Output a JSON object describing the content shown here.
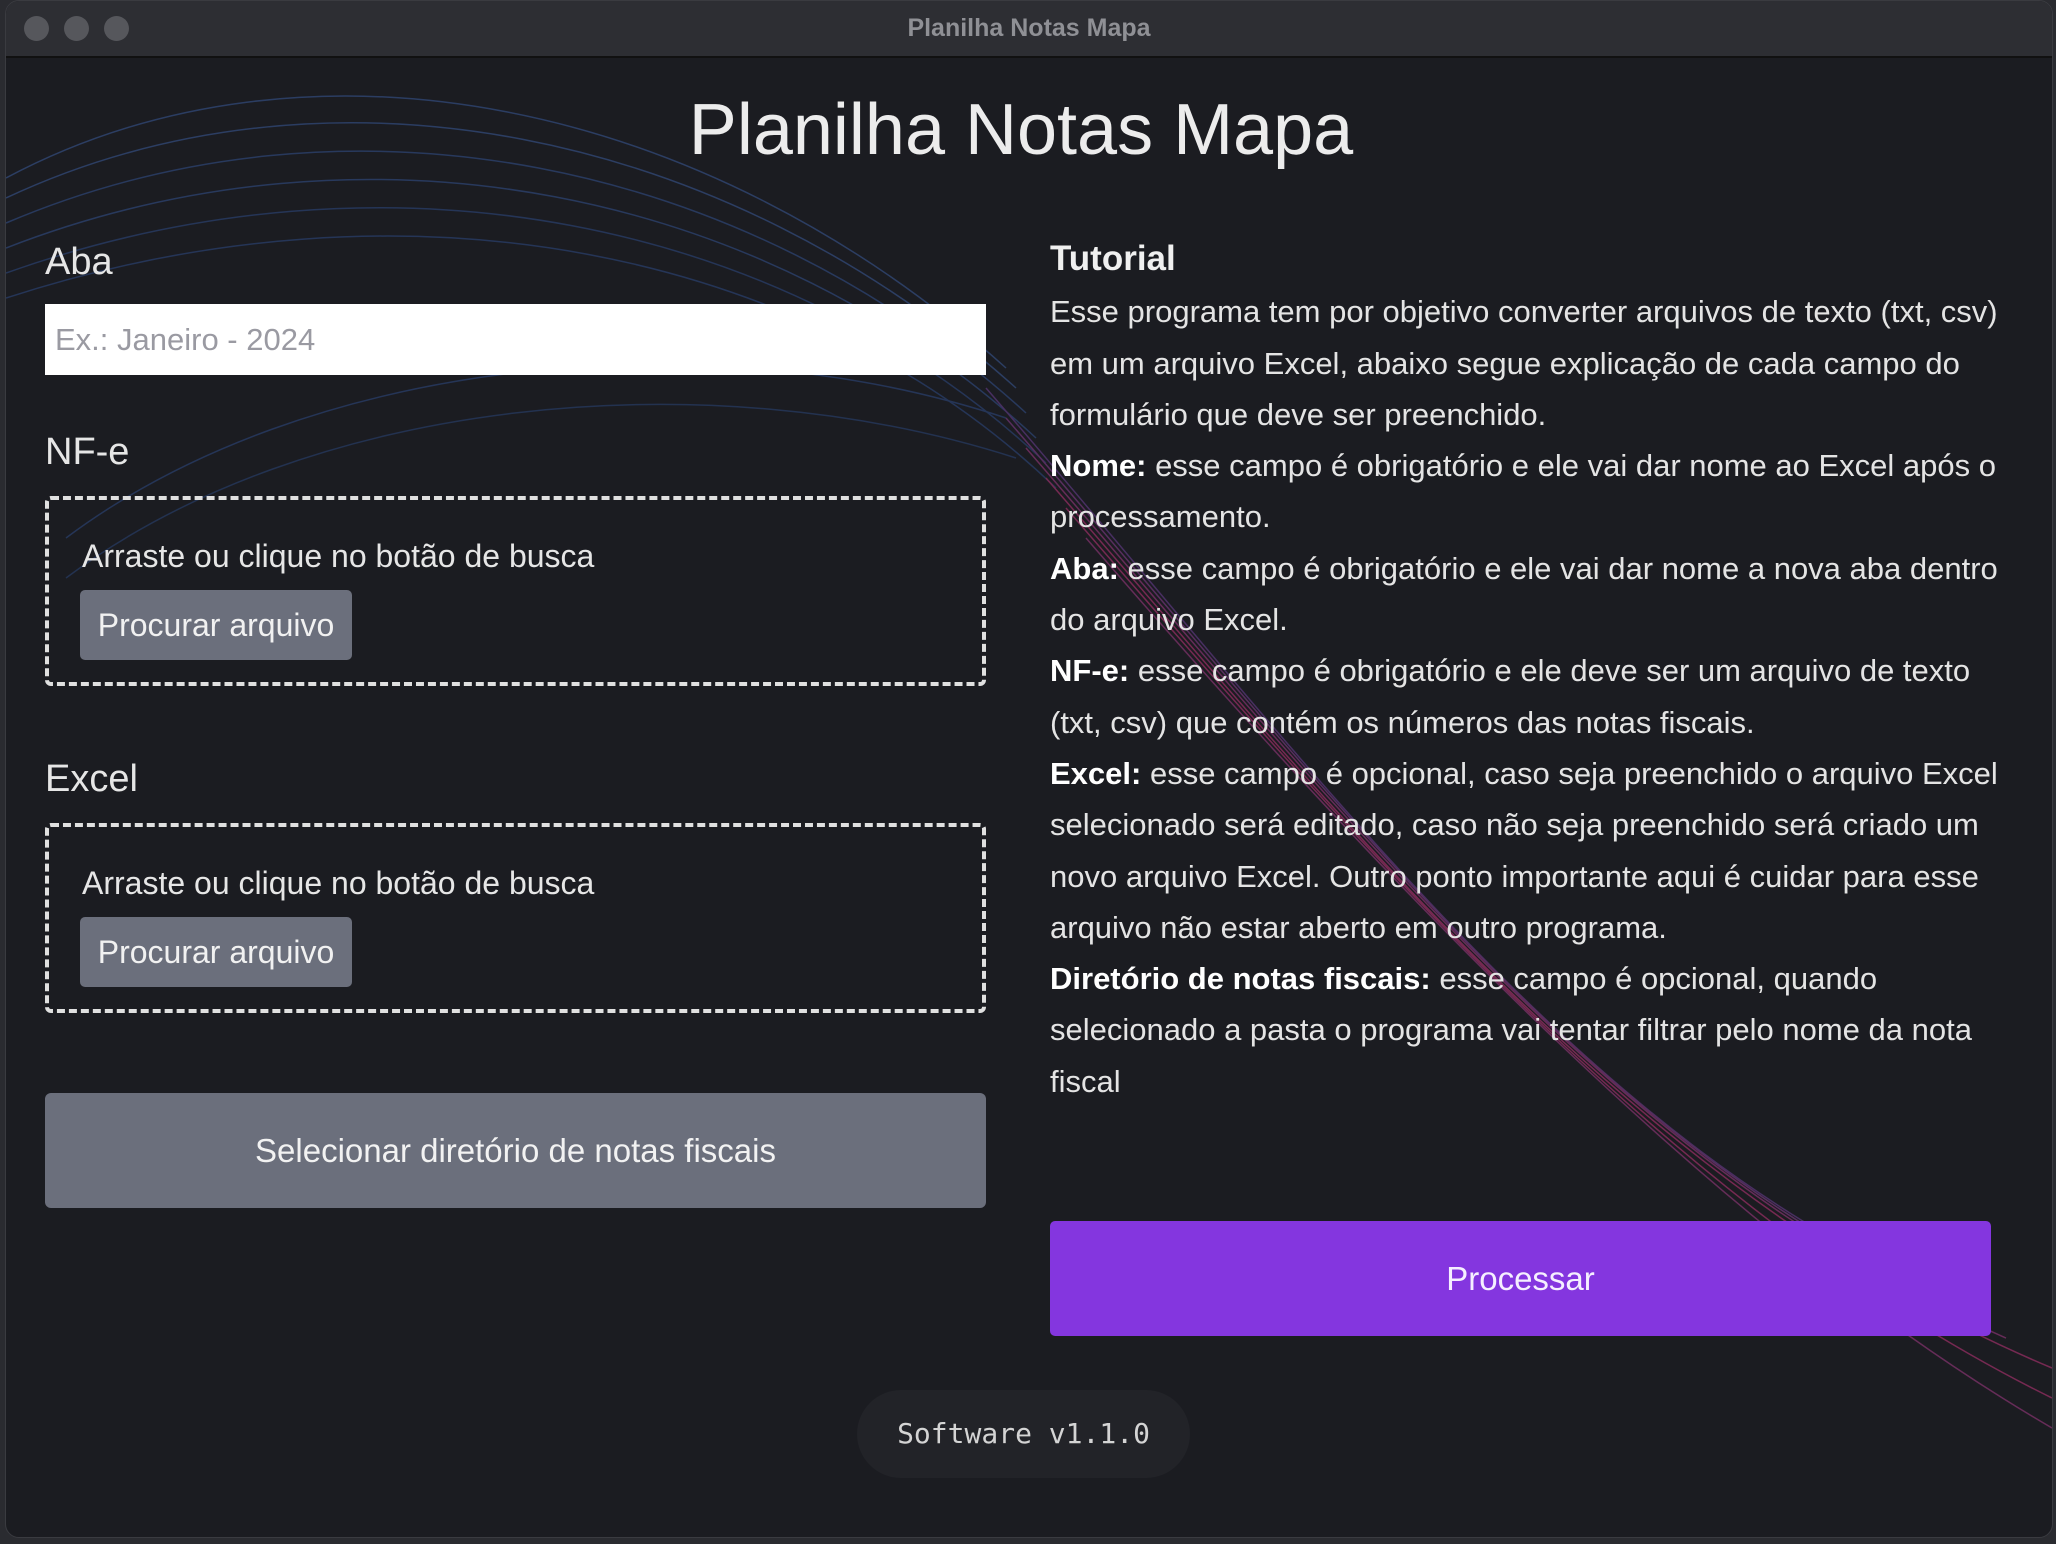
{
  "window": {
    "title": "Planilha Notas Mapa"
  },
  "app": {
    "title": "Planilha Notas Mapa"
  },
  "form": {
    "aba": {
      "label": "Aba",
      "placeholder": "Ex.: Janeiro - 2024",
      "value": ""
    },
    "nfe": {
      "label": "NF-e",
      "hint": "Arraste ou clique no botão de busca",
      "button": "Procurar arquivo"
    },
    "excel": {
      "label": "Excel",
      "hint": "Arraste ou clique no botão de busca",
      "button": "Procurar arquivo"
    },
    "directory_button": "Selecionar diretório de notas fiscais"
  },
  "tutorial": {
    "title": "Tutorial",
    "intro": "Esse programa tem por objetivo converter arquivos de texto (txt, csv) em um arquivo Excel, abaixo segue explicação de cada campo do formulário que deve ser preenchido.",
    "items": [
      {
        "term": "Nome:",
        "text": " esse campo é obrigatório e ele vai dar nome ao Excel após o processamento."
      },
      {
        "term": "Aba:",
        "text": " esse campo é obrigatório e ele vai dar nome a nova aba dentro do arquivo Excel."
      },
      {
        "term": "NF-e:",
        "text": " esse campo é obrigatório e ele deve ser um arquivo de texto (txt, csv) que contém os números das notas fiscais."
      },
      {
        "term": "Excel:",
        "text": " esse campo é opcional, caso seja preenchido o arquivo Excel selecionado será editado, caso não seja preenchido será criado um novo arquivo Excel. Outro ponto importante aqui é cuidar para esse arquivo não estar aberto em outro programa."
      },
      {
        "term": "Diretório de notas fiscais:",
        "text": " esse campo é opcional, quando selecionado a pasta o programa vai tentar filtrar pelo nome da nota fiscal"
      }
    ]
  },
  "actions": {
    "process_button": "Processar"
  },
  "footer": {
    "version": "Software v1.1.0"
  },
  "colors": {
    "background": "#1b1c21",
    "accent": "#8436df",
    "secondary_button": "#6b6f7c",
    "wave_blue": "#3a5a9a",
    "wave_pink": "#c2357a"
  }
}
